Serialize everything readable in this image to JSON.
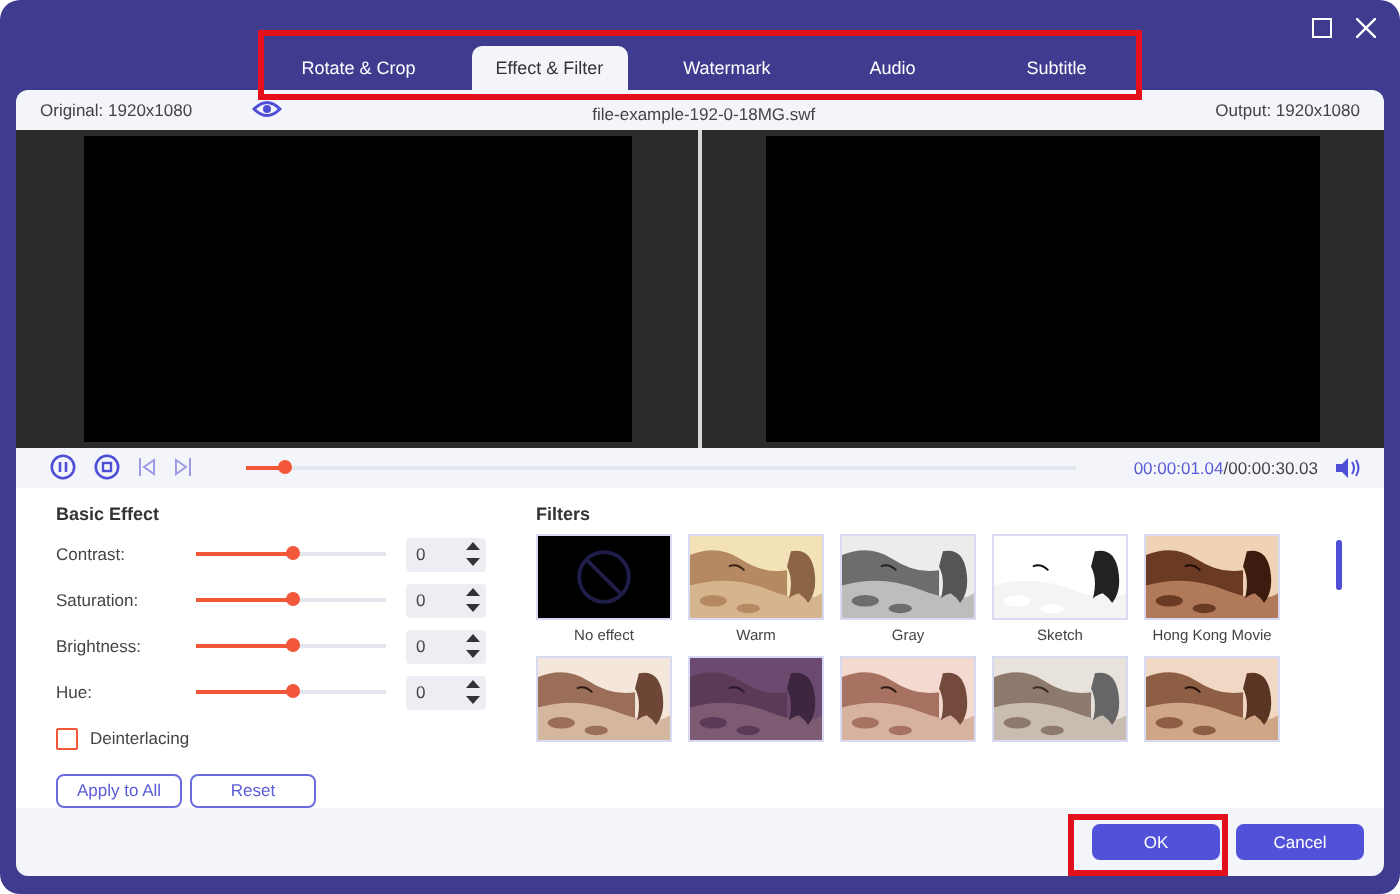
{
  "tabs": [
    {
      "label": "Rotate & Crop",
      "selected": false
    },
    {
      "label": "Effect & Filter",
      "selected": true
    },
    {
      "label": "Watermark",
      "selected": false
    },
    {
      "label": "Audio",
      "selected": false
    },
    {
      "label": "Subtitle",
      "selected": false
    }
  ],
  "preview": {
    "original": "Original: 1920x1080",
    "filename": "file-example-192-0-18MG.swf",
    "output": "Output: 1920x1080"
  },
  "playback": {
    "level": 0.045,
    "current": "00:00:01.04",
    "total": "/00:00:30.03"
  },
  "basic_effect": {
    "title": "Basic Effect",
    "adjustments": [
      {
        "label": "Contrast:",
        "level": 0.5,
        "value": "0"
      },
      {
        "label": "Saturation:",
        "level": 0.5,
        "value": "0"
      },
      {
        "label": "Brightness:",
        "level": 0.5,
        "value": "0"
      },
      {
        "label": "Hue:",
        "level": 0.5,
        "value": "0"
      }
    ],
    "deinterlacing": {
      "label": "Deinterlacing",
      "checked": false
    },
    "buttons": [
      "Apply to All",
      "Reset"
    ]
  },
  "filters": {
    "title": "Filters",
    "items": [
      {
        "kind": "none",
        "label": "No effect"
      },
      {
        "kind": "picture",
        "label": "Warm"
      },
      {
        "kind": "picture",
        "label": "Gray"
      },
      {
        "kind": "picture",
        "label": "Sketch"
      },
      {
        "kind": "picture",
        "label": "Hong Kong Movie"
      },
      {
        "kind": "picture"
      },
      {
        "kind": "picture"
      },
      {
        "kind": "picture"
      },
      {
        "kind": "picture"
      },
      {
        "kind": "picture"
      }
    ]
  },
  "footer": {
    "buttons": [
      "OK",
      "Cancel"
    ]
  }
}
